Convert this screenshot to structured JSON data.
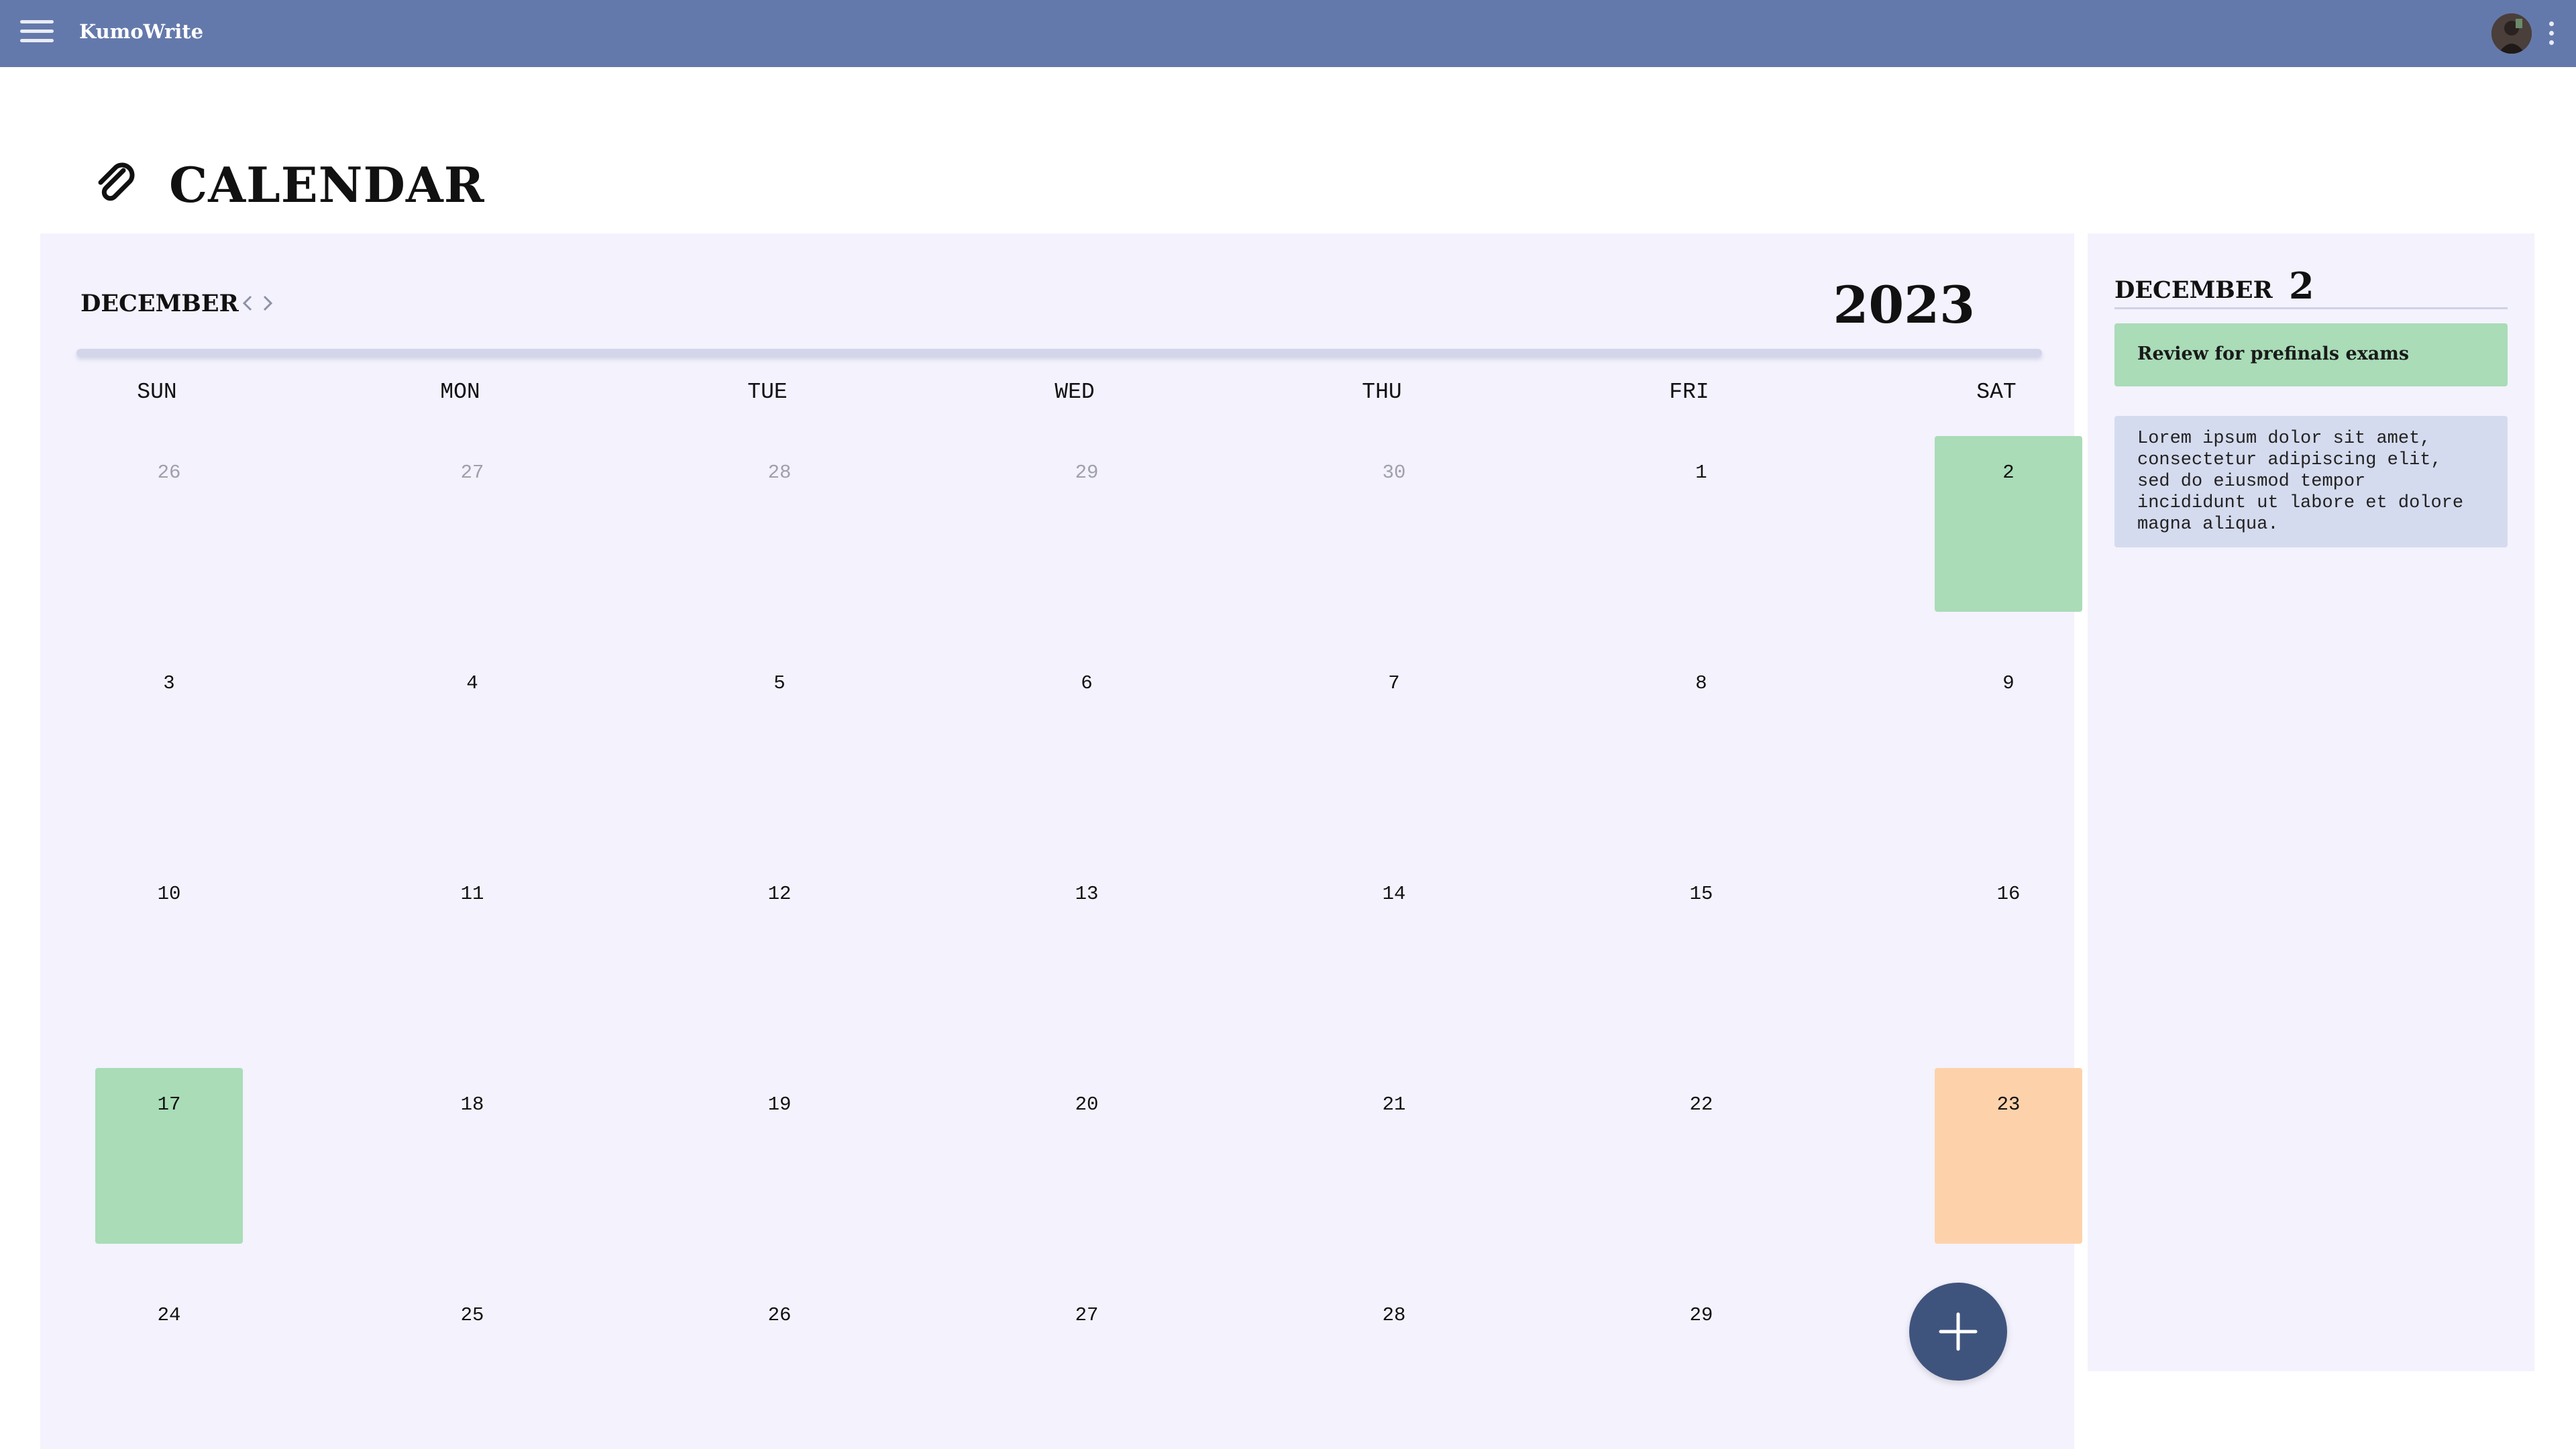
{
  "app": {
    "name": "KumoWrite"
  },
  "page": {
    "title": "CALENDAR"
  },
  "calendar": {
    "month": "DECEMBER",
    "year": "2023",
    "weekdays": [
      "SUN",
      "MON",
      "TUE",
      "WED",
      "THU",
      "FRI",
      "SAT"
    ],
    "days": [
      {
        "label": "26",
        "muted": true
      },
      {
        "label": "27",
        "muted": true
      },
      {
        "label": "28",
        "muted": true
      },
      {
        "label": "29",
        "muted": true
      },
      {
        "label": "30",
        "muted": true
      },
      {
        "label": "1"
      },
      {
        "label": "2",
        "highlight": "green"
      },
      {
        "label": "3"
      },
      {
        "label": "4"
      },
      {
        "label": "5"
      },
      {
        "label": "6"
      },
      {
        "label": "7"
      },
      {
        "label": "8"
      },
      {
        "label": "9"
      },
      {
        "label": "10"
      },
      {
        "label": "11"
      },
      {
        "label": "12"
      },
      {
        "label": "13"
      },
      {
        "label": "14"
      },
      {
        "label": "15"
      },
      {
        "label": "16"
      },
      {
        "label": "17",
        "highlight": "green"
      },
      {
        "label": "18"
      },
      {
        "label": "19"
      },
      {
        "label": "20"
      },
      {
        "label": "21"
      },
      {
        "label": "22"
      },
      {
        "label": "23",
        "highlight": "orange"
      },
      {
        "label": "24"
      },
      {
        "label": "25"
      },
      {
        "label": "26"
      },
      {
        "label": "27"
      },
      {
        "label": "28"
      },
      {
        "label": "29"
      }
    ],
    "icons": {
      "prev": "chevron-left-icon",
      "next": "chevron-right-icon",
      "add": "plus-icon"
    }
  },
  "details": {
    "month": "DECEMBER",
    "day": "2",
    "event_title": "Review for prefinals exams",
    "note": "Lorem ipsum dolor sit amet,\nconsectetur adipiscing elit,\nsed do eiusmod tempor\nincididunt ut labore et dolore\nmagna aliqua."
  },
  "colors": {
    "topbar": "#6479ab",
    "panel": "#f3f2fd",
    "event_green": "#a9dcb7",
    "event_orange": "#fdd2ab",
    "note_bg": "#d5dbee",
    "fab": "#3f547d"
  }
}
